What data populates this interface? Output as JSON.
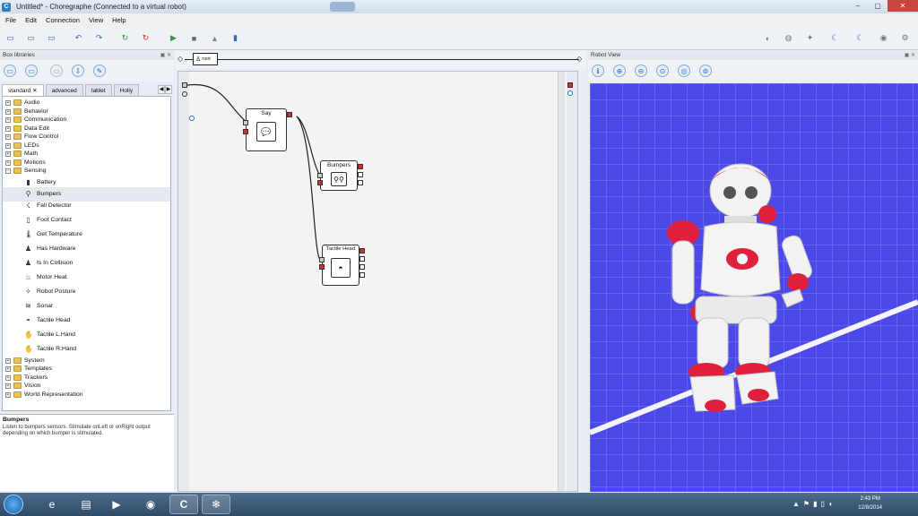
{
  "window": {
    "title": "Untitled* - Choregraphe (Connected to a virtual robot)",
    "app_letter": "C",
    "controls": [
      "–",
      "▢",
      "✕"
    ]
  },
  "menu": [
    "File",
    "Edit",
    "Connection",
    "View",
    "Help"
  ],
  "panels": {
    "box_libraries": "Box libraries",
    "robot_view": "Robot View"
  },
  "library_tabs": [
    "standard",
    "advanced",
    "tablet",
    "Holly"
  ],
  "tree": {
    "folders_top": [
      "Audio",
      "Behavior",
      "Communication",
      "Data Edit",
      "Flow Control",
      "LEDs",
      "Math",
      "Motions",
      "Sensing"
    ],
    "sensing_children": [
      "Battery",
      "Bumpers",
      "Fall Detector",
      "Foot Contact",
      "Get Temperature",
      "Has Hardware",
      "Is In Collision",
      "Motor Heat",
      "Robot Posture",
      "Sonar",
      "Tactile Head",
      "Tactile L.Hand",
      "Tactile R.Hand"
    ],
    "folders_bottom": [
      "System",
      "Templates",
      "Trackers",
      "Vision",
      "World Representation"
    ]
  },
  "description": {
    "title": "Bumpers",
    "text": "Listen to bumpers sensors. Stimulate onLeft or onRight output depending on which bumper is stimulated."
  },
  "flow": {
    "root_label": "root",
    "boxes": {
      "say": "Say",
      "bumpers": "Bumpers",
      "tactile": "Tactile Head"
    }
  },
  "taskbar": {
    "time": "2:43 PM",
    "date": "12/8/2014",
    "app_letter": "C"
  },
  "colors": {
    "scene_blue": "#4d49e8",
    "robot_red": "#e0213e"
  }
}
